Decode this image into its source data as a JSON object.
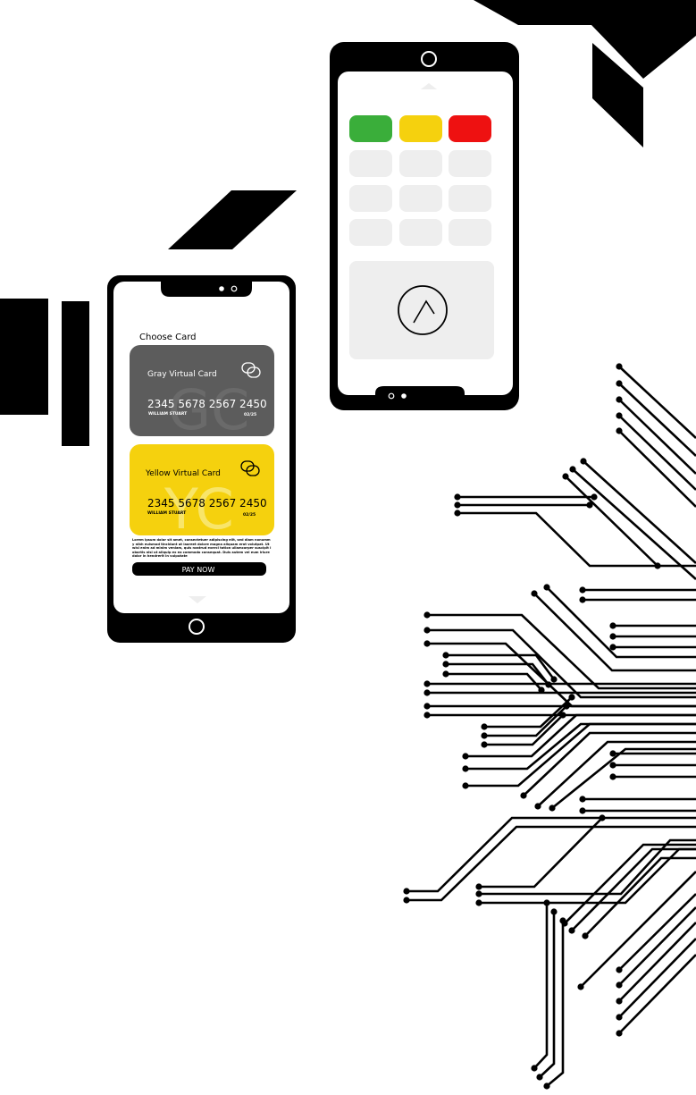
{
  "colors": {
    "ink": "#000000",
    "screen_gray": "#eeeeee",
    "gray_card": "#5c5c5c",
    "yellow_card": "#f5d10e",
    "green_key": "#3aae3a",
    "yellow_key": "#f5d10e",
    "red_key": "#ee1111"
  },
  "choose_card": {
    "title": "Choose Card",
    "cards": [
      {
        "name": "Gray Virtual Card",
        "watermark": "GC",
        "number": "2345 5678 2567 2450",
        "holder": "WILLIAM STUART",
        "expiry": "02/25"
      },
      {
        "name": "Yellow Virtual Card",
        "watermark": "YC",
        "number": "2345 5678 2567 2450",
        "holder": "WILLIAM STUART",
        "expiry": "02/25"
      }
    ],
    "fine_print": "Lorem ipsum dolor sit amet, consectetuer adipiscing elit, sed diam nonummy nibh euismod tincidunt ut laoreet dolore magna aliquam erat volutpat. Ut wisi enim ad minim veniam, quis nostrud exerci tation ullamcorper suscipit lobortis nisl ut aliquip ex ea commodo consequat. Duis autem vel eum iriure dolor in hendrerit in vulputate",
    "pay_label": "PAY NOW"
  },
  "icons": {
    "card_brand": "overlapping-rings-icon",
    "up_arrow": "chevron-up-icon",
    "down_arrow": "triangle-down-icon",
    "home_button": "home-button-icon",
    "camera": "camera-dot-icon"
  }
}
